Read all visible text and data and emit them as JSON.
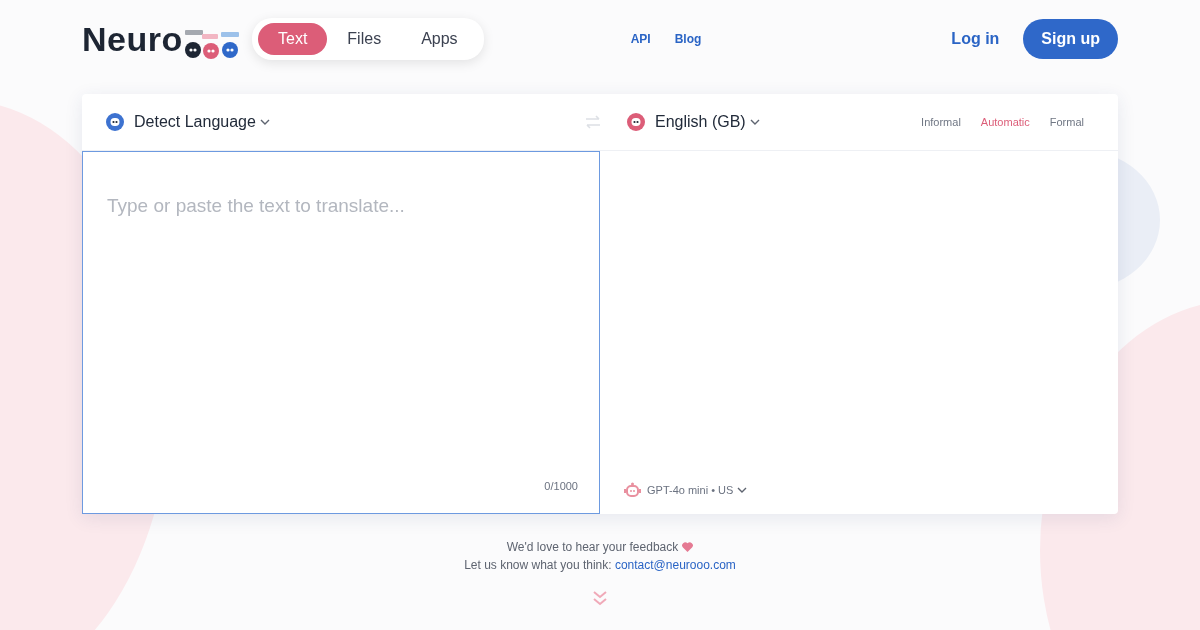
{
  "header": {
    "logo": "Neuro",
    "tabs": [
      {
        "label": "Text",
        "selected": true
      },
      {
        "label": "Files",
        "selected": false
      },
      {
        "label": "Apps",
        "selected": false
      }
    ],
    "links": [
      "API",
      "Blog"
    ],
    "login": "Log in",
    "signup": "Sign up"
  },
  "translator": {
    "source_language": "Detect Language",
    "target_language": "English (GB)",
    "tones": [
      {
        "label": "Informal",
        "selected": false
      },
      {
        "label": "Automatic",
        "selected": true
      },
      {
        "label": "Formal",
        "selected": false
      }
    ],
    "input": {
      "placeholder": "Type or paste the text to translate...",
      "counter": "0/1000"
    },
    "model": "GPT-4o mini • US"
  },
  "footer": {
    "feedback": "We'd love to hear your feedback",
    "contact_text": "Let us know what you think:",
    "contact_link": "contact@neurooo.com"
  }
}
